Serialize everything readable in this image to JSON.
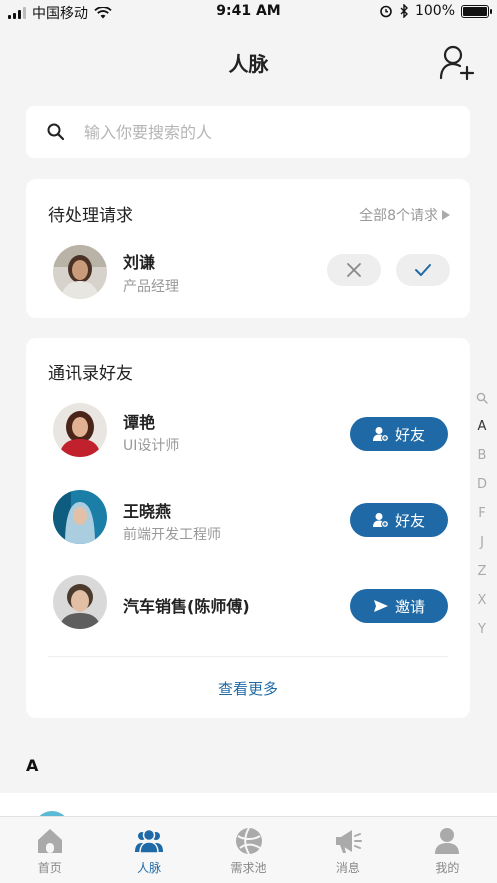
{
  "status_bar": {
    "carrier": "中国移动",
    "time": "9:41 AM",
    "battery": "100%"
  },
  "header": {
    "title": "人脉"
  },
  "search": {
    "placeholder": "输入你要搜索的人"
  },
  "pending": {
    "title": "待处理请求",
    "all_label": "全部8个请求",
    "person": {
      "name": "刘谦",
      "role": "产品经理"
    }
  },
  "contacts": {
    "title": "通讯录好友",
    "items": [
      {
        "name": "谭艳",
        "role": "UI设计师",
        "action": "好友",
        "action_icon": "user-plus-icon"
      },
      {
        "name": "王晓燕",
        "role": "前端开发工程师",
        "action": "好友",
        "action_icon": "user-plus-icon"
      },
      {
        "name": "汽车销售(陈师傅)",
        "role": "",
        "action": "邀请",
        "action_icon": "send-icon"
      }
    ],
    "see_more": "查看更多"
  },
  "index_letters": [
    "A",
    "B",
    "D",
    "F",
    "J",
    "Z",
    "X",
    "Y"
  ],
  "section_letter": "A",
  "tabs": [
    {
      "label": "首页",
      "icon": "home-icon"
    },
    {
      "label": "人脉",
      "icon": "contacts-icon",
      "active": true
    },
    {
      "label": "需求池",
      "icon": "globe-icon"
    },
    {
      "label": "消息",
      "icon": "megaphone-icon"
    },
    {
      "label": "我的",
      "icon": "user-icon"
    }
  ],
  "colors": {
    "accent": "#1f6aa6",
    "background": "#f4f4f4",
    "muted": "#999999"
  }
}
